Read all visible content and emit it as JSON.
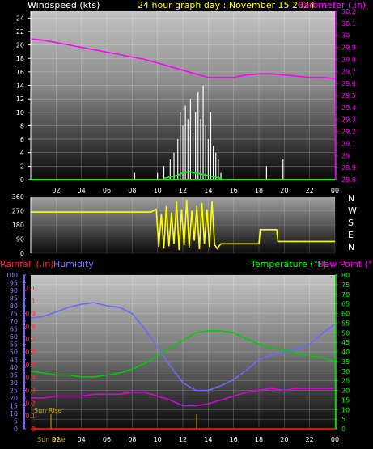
{
  "header": {
    "left": "Windspeed (kts)",
    "center": "24 hour graph day : November 15 2024",
    "right": "Barometer (.in)"
  },
  "bottom_header": {
    "rainfall": "Rainfall (.in)",
    "humidity": "Humidity",
    "temperature": "Temperature (°F)",
    "dewpoint": "Dew Point (°F)"
  },
  "labels": {
    "sunrise_in_plot": "Sun Rise",
    "sunrise_axis": "Sun Rise"
  },
  "colors": {
    "windspeed": "#ffffff",
    "gust": "#00ff00",
    "barometer": "#ff00ff",
    "direction": "#ffff00",
    "humidity": "#6a6aff",
    "temperature": "#00cc00",
    "dewpoint": "#dd00dd",
    "rainfall": "#ff0000",
    "left_axis": "#6a6aff",
    "right_axis": "#00ff00",
    "sunrise": "#ccaa00"
  },
  "chart_data": [
    {
      "type": "line",
      "name": "wind-baro",
      "x_ticks": [
        "02",
        "04",
        "06",
        "08",
        "10",
        "12",
        "14",
        "16",
        "18",
        "20",
        "22",
        "00"
      ],
      "x_range": [
        0,
        24
      ],
      "y_left": {
        "label": "Windspeed (kts)",
        "range": [
          0,
          25
        ],
        "ticks": [
          "0",
          "2",
          "4",
          "6",
          "8",
          "10",
          "12",
          "14",
          "16",
          "18",
          "20",
          "22",
          "24"
        ]
      },
      "y_right": {
        "label": "Barometer (.in)",
        "range": [
          28.8,
          30.2
        ],
        "ticks": [
          "28.8",
          "28.9",
          "29",
          "29.1",
          "29.2",
          "29.3",
          "29.4",
          "29.5",
          "29.6",
          "29.7",
          "29.8",
          "29.9",
          "30",
          "30.1",
          "30.2"
        ]
      },
      "series": [
        {
          "name": "Barometer",
          "axis": "right",
          "x": [
            0,
            1,
            2,
            3,
            4,
            5,
            6,
            7,
            8,
            9,
            10,
            11,
            12,
            13,
            14,
            15,
            16,
            17,
            18,
            19,
            20,
            21,
            22,
            23,
            24
          ],
          "values": [
            29.97,
            29.96,
            29.94,
            29.92,
            29.9,
            29.88,
            29.86,
            29.84,
            29.82,
            29.8,
            29.77,
            29.74,
            29.71,
            29.68,
            29.65,
            29.65,
            29.65,
            29.67,
            29.68,
            29.68,
            29.67,
            29.66,
            29.65,
            29.65,
            29.64
          ]
        },
        {
          "name": "Windspeed",
          "axis": "left",
          "x": [
            8.2,
            10.0,
            10.5,
            11.0,
            11.3,
            11.6,
            11.8,
            12.0,
            12.2,
            12.4,
            12.6,
            12.8,
            13.0,
            13.2,
            13.4,
            13.6,
            13.8,
            14.0,
            14.2,
            14.4,
            14.6,
            14.8,
            15.0,
            18.6,
            19.9
          ],
          "values": [
            1,
            1,
            2,
            3,
            4,
            6,
            10,
            8,
            11,
            9,
            12,
            7,
            10,
            13,
            9,
            14,
            8,
            6,
            10,
            5,
            4,
            3,
            1,
            2,
            3
          ]
        },
        {
          "name": "Gust",
          "axis": "left",
          "x": [
            10.5,
            11,
            11.5,
            12,
            12.5,
            13,
            13.5,
            14,
            14.5,
            15
          ],
          "values": [
            0.2,
            0.4,
            0.6,
            1.0,
            1.2,
            1.0,
            0.8,
            0.6,
            0.4,
            0.2
          ]
        }
      ]
    },
    {
      "type": "line",
      "name": "wind-direction",
      "x_range": [
        0,
        24
      ],
      "y_left": {
        "range": [
          0,
          360
        ],
        "ticks": [
          "0",
          "90",
          "180",
          "270",
          "360"
        ]
      },
      "y_right_labels": [
        "N",
        "W",
        "S",
        "E",
        "N"
      ],
      "series": [
        {
          "name": "Direction",
          "x": [
            0,
            9.5,
            9.9,
            10.1,
            10.3,
            10.5,
            10.7,
            10.9,
            11.1,
            11.3,
            11.5,
            11.7,
            11.9,
            12.1,
            12.3,
            12.5,
            12.7,
            12.9,
            13.1,
            13.3,
            13.5,
            13.7,
            13.9,
            14.1,
            14.3,
            14.5,
            14.7,
            15.0,
            15.5,
            17.0,
            18.0,
            18.1,
            19.4,
            19.5,
            24
          ],
          "values": [
            262,
            262,
            280,
            40,
            250,
            30,
            300,
            45,
            260,
            60,
            330,
            20,
            280,
            50,
            340,
            35,
            270,
            80,
            300,
            25,
            320,
            60,
            280,
            40,
            330,
            55,
            30,
            60,
            60,
            60,
            60,
            150,
            150,
            75,
            75
          ]
        }
      ]
    },
    {
      "type": "line",
      "name": "humidity-temp",
      "x_ticks": [
        "02",
        "04",
        "06",
        "08",
        "10",
        "12",
        "14",
        "16",
        "18",
        "20",
        "22",
        "00"
      ],
      "x_range": [
        0,
        24
      ],
      "y_left_humidity": {
        "label": "Humidity",
        "range": [
          0,
          100
        ],
        "ticks": [
          "0",
          "5",
          "10",
          "15",
          "20",
          "25",
          "30",
          "35",
          "40",
          "45",
          "50",
          "55",
          "60",
          "65",
          "70",
          "75",
          "80",
          "85",
          "90",
          "95",
          "100"
        ]
      },
      "y_left_rainfall": {
        "label": "Rainfall (.in)",
        "range": [
          0,
          1.2
        ],
        "ticks": [
          "0",
          "0.1",
          "0.2",
          "0.3",
          "0.4",
          "0.5",
          "0.6",
          "0.7",
          "0.8",
          "0.9",
          "1",
          "1.1"
        ]
      },
      "y_right": {
        "label": "Temperature (°F)",
        "range": [
          0,
          80
        ],
        "ticks": [
          "0",
          "5",
          "10",
          "15",
          "20",
          "25",
          "30",
          "35",
          "40",
          "45",
          "50",
          "55",
          "60",
          "65",
          "70",
          "75",
          "80"
        ]
      },
      "series": [
        {
          "name": "Humidity",
          "axis": "humidity",
          "x": [
            0,
            1,
            2,
            3,
            4,
            5,
            6,
            7,
            8,
            9,
            10,
            11,
            12,
            13,
            14,
            15,
            16,
            17,
            18,
            19,
            20,
            21,
            22,
            23,
            24
          ],
          "values": [
            72,
            73,
            76,
            79,
            81,
            82,
            80,
            79,
            75,
            65,
            53,
            41,
            30,
            25,
            25,
            28,
            32,
            38,
            45,
            48,
            50,
            52,
            55,
            62,
            68
          ]
        },
        {
          "name": "Temperature",
          "axis": "right",
          "x": [
            0,
            1,
            2,
            3,
            4,
            5,
            6,
            7,
            8,
            9,
            10,
            11,
            12,
            13,
            14,
            15,
            16,
            17,
            18,
            19,
            20,
            21,
            22,
            23,
            24
          ],
          "values": [
            30,
            29,
            28,
            28,
            27,
            27,
            28,
            29,
            31,
            34,
            38,
            42,
            46,
            50,
            51,
            51,
            50,
            47,
            44,
            42,
            41,
            39,
            38,
            37,
            35
          ]
        },
        {
          "name": "Dew Point",
          "axis": "right",
          "x": [
            0,
            1,
            2,
            3,
            4,
            5,
            6,
            7,
            8,
            9,
            10,
            11,
            12,
            13,
            14,
            15,
            16,
            17,
            18,
            19,
            20,
            21,
            22,
            23,
            24
          ],
          "values": [
            16,
            16,
            17,
            17,
            17,
            18,
            18,
            18,
            19,
            19,
            17,
            15,
            12,
            12,
            13,
            15,
            17,
            19,
            20,
            21,
            20,
            21,
            21,
            21,
            21
          ]
        },
        {
          "name": "Rainfall",
          "axis": "rainfall",
          "x": [
            0,
            24
          ],
          "values": [
            0,
            0
          ]
        }
      ]
    }
  ]
}
